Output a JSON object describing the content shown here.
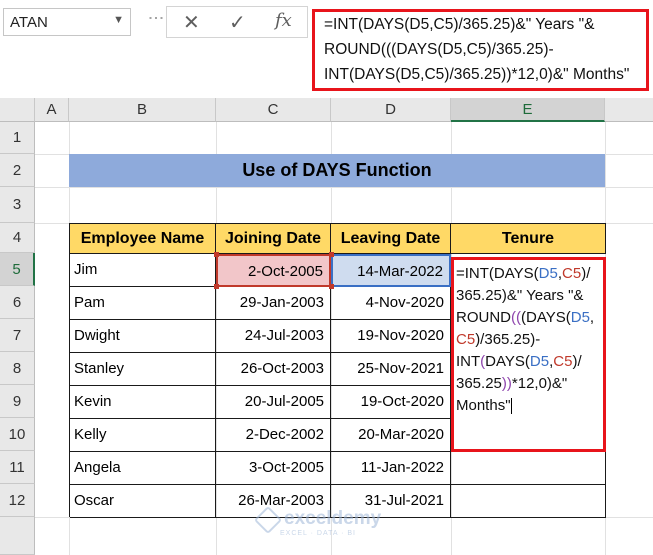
{
  "name_box": {
    "value": "ATAN"
  },
  "formula_bar": {
    "buttons": [
      "✕",
      "✓",
      "fx"
    ],
    "lines": [
      "=INT(DAYS(D5,C5)/365.25)&\" Years \"&",
      "ROUND(((DAYS(D5,C5)/365.25)-",
      "INT(DAYS(D5,C5)/365.25))*12,0)&\" Months\""
    ]
  },
  "columns": [
    "A",
    "B",
    "C",
    "D",
    "E"
  ],
  "rows": [
    "1",
    "2",
    "3",
    "4",
    "5",
    "6",
    "7",
    "8",
    "9",
    "10",
    "11",
    "12"
  ],
  "title": "Use of DAYS Function",
  "table": {
    "headers": [
      "Employee Name",
      "Joining Date",
      "Leaving Date",
      "Tenure"
    ],
    "rows": [
      [
        "Jim",
        "2-Oct-2005",
        "14-Mar-2022"
      ],
      [
        "Pam",
        "29-Jan-2003",
        "4-Nov-2020"
      ],
      [
        "Dwight",
        "24-Jul-2003",
        "19-Nov-2020"
      ],
      [
        "Stanley",
        "26-Oct-2003",
        "25-Nov-2021"
      ],
      [
        "Kevin",
        "20-Jul-2005",
        "19-Oct-2020"
      ],
      [
        "Kelly",
        "2-Dec-2002",
        "20-Mar-2020"
      ],
      [
        "Angela",
        "3-Oct-2005",
        "11-Jan-2022"
      ],
      [
        "Oscar",
        "26-Mar-2003",
        "31-Jul-2021"
      ]
    ]
  },
  "cell_edit": {
    "l1a": "=INT(DAYS(",
    "l1b": "D5",
    "l1c": ",",
    "l1d": "C5",
    "l1e": ")/",
    "l2": "365.25)&\" Years \"&",
    "l3a": "ROUND",
    "l3b": "((",
    "l3c": "(DAYS(",
    "l3d": "D5",
    "l3e": ",",
    "l4a": "C5",
    "l4b": ")/365.25)-",
    "l5a": "INT",
    "l5b": "(",
    "l5c": "DAYS(",
    "l5d": "D5",
    "l5e": ",",
    "l5f": "C5",
    "l5g": ")/",
    "l6a": "365.25",
    "l6b": "))",
    "l6c": "*12,0)&\"",
    "l7": "Months\""
  },
  "watermark": {
    "brand": "exceldemy",
    "tagline": "EXCEL · DATA · BI"
  },
  "colors": {
    "title_band": "#8eaadb",
    "header_fill": "#ffd966",
    "highlight_border": "#e8141b"
  }
}
